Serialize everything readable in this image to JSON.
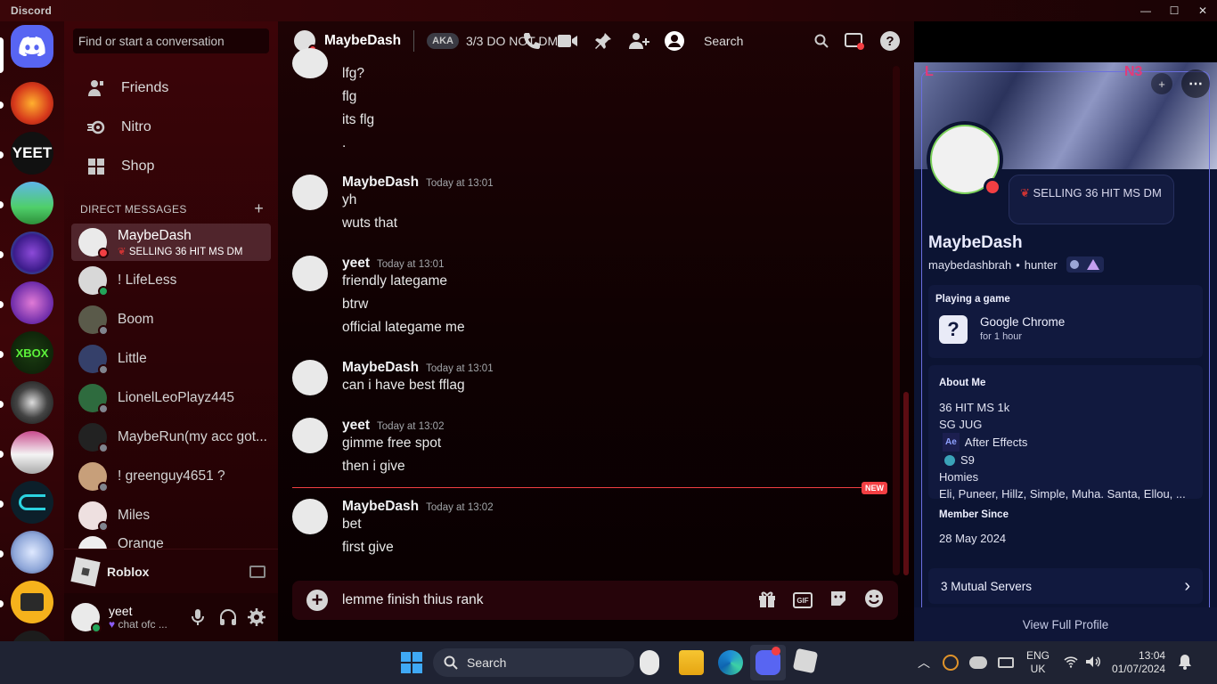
{
  "window": {
    "app_name": "Discord",
    "min": "—",
    "max": "☐",
    "close": "✕"
  },
  "dm_sidebar": {
    "search_placeholder": "Find or start a conversation",
    "nav": [
      {
        "label": "Friends"
      },
      {
        "label": "Nitro"
      },
      {
        "label": "Shop"
      }
    ],
    "section_label": "DIRECT MESSAGES",
    "add_label": "+",
    "dms": [
      {
        "name": "MaybeDash",
        "status": "SELLING 36 HIT MS DM",
        "state": "dnd",
        "active": true
      },
      {
        "name": "! LifeLess",
        "state": "on"
      },
      {
        "name": "Boom",
        "state": "off"
      },
      {
        "name": "Little",
        "state": "off"
      },
      {
        "name": "LionelLeoPlayz445",
        "state": "off"
      },
      {
        "name": "MaybeRun(my acc got...",
        "state": "off"
      },
      {
        "name": "! greenguy4651 ?",
        "state": "off"
      },
      {
        "name": "Miles",
        "state": "off"
      },
      {
        "name": "Orange",
        "state": "off"
      }
    ],
    "activity": {
      "name": "Roblox"
    },
    "user": {
      "name": "yeet",
      "status": "chat ofc ..."
    }
  },
  "chat": {
    "header_name": "MaybeDash",
    "aka_label": "AKA",
    "aka_value": "3/3 DO NOT DM",
    "search_label": "Search",
    "groups": [
      {
        "author": "",
        "time": "",
        "lines": [
          "lfg?",
          "flg",
          "its flg",
          "."
        ]
      },
      {
        "author": "MaybeDash",
        "time": "Today at 13:01",
        "lines": [
          "yh",
          "wuts that"
        ]
      },
      {
        "author": "yeet",
        "time": "Today at 13:01",
        "lines": [
          "friendly lategame",
          "btrw",
          "official lategame me"
        ]
      },
      {
        "author": "MaybeDash",
        "time": "Today at 13:01",
        "lines": [
          "can i have best fflag"
        ]
      },
      {
        "author": "yeet",
        "time": "Today at 13:02",
        "lines": [
          "gimme free spot",
          "then i give"
        ]
      },
      {
        "author": "MaybeDash",
        "time": "Today at 13:02",
        "lines": [
          "bet",
          "first give"
        ]
      }
    ],
    "new_label": "NEW",
    "composer_text": "lemme finish thius rank"
  },
  "profile": {
    "custom_status": "SELLING 36 HIT MS DM",
    "display_name": "MaybeDash",
    "username": "maybedashbrah",
    "pronouns": "hunter",
    "bullet": "•",
    "corner_left": "L",
    "corner_right": "N3",
    "playing": {
      "heading": "Playing a game",
      "game": "Google Chrome",
      "duration": "for 1 hour"
    },
    "about": {
      "heading": "About Me",
      "lines": [
        "36 HIT MS 1k",
        "SG JUG"
      ],
      "ae_badge": "Ae",
      "ae_label": "After Effects",
      "s9_label": "S9",
      "homies": "Homies",
      "homies_list": "Eli, Puneer, Hillz, Simple, Muha. Santa, Ellou, ..."
    },
    "member_since": {
      "heading": "Member Since",
      "date": "28 May 2024"
    },
    "mutual_servers": "3 Mutual Servers",
    "view_full": "View Full Profile"
  },
  "taskbar": {
    "search_label": "Search",
    "lang_top": "ENG",
    "lang_bottom": "UK",
    "time": "13:04",
    "date": "01/07/2024"
  }
}
